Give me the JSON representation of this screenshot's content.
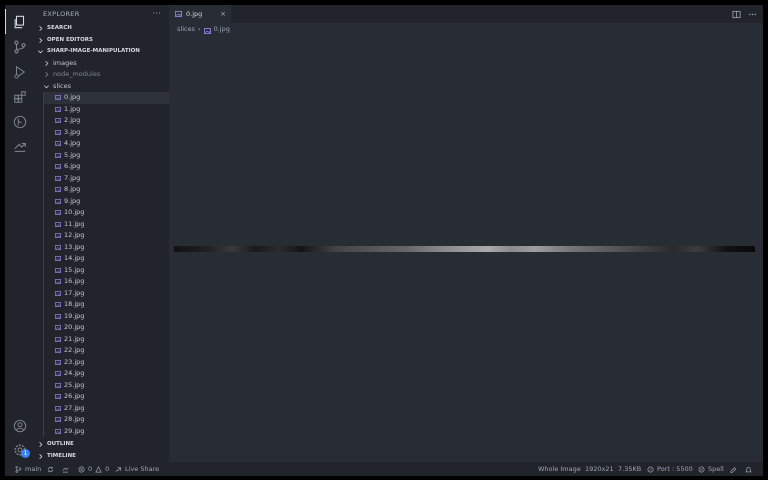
{
  "sidebar": {
    "title": "EXPLORER",
    "more": "···",
    "sections": {
      "search": "SEARCH",
      "open_editors": "OPEN EDITORS",
      "project": "SHARP-IMAGE-MANIPULATION",
      "outline": "OUTLINE",
      "timeline": "TIMELINE"
    },
    "folders": {
      "images": "images",
      "node_modules": "node_modules",
      "slices": "slices"
    },
    "files": [
      "0.jpg",
      "1.jpg",
      "2.jpg",
      "3.jpg",
      "4.jpg",
      "5.jpg",
      "6.jpg",
      "7.jpg",
      "8.jpg",
      "9.jpg",
      "10.jpg",
      "11.jpg",
      "12.jpg",
      "13.jpg",
      "14.jpg",
      "15.jpg",
      "16.jpg",
      "17.jpg",
      "18.jpg",
      "19.jpg",
      "20.jpg",
      "21.jpg",
      "22.jpg",
      "23.jpg",
      "24.jpg",
      "25.jpg",
      "26.jpg",
      "27.jpg",
      "28.jpg",
      "29.jpg"
    ]
  },
  "activity": {
    "settings_badge": "1"
  },
  "editor": {
    "tab_label": "0.jpg",
    "tab_close": "×",
    "breadcrumb": {
      "folder": "slices",
      "separator": "›",
      "file": "0.jpg"
    }
  },
  "status": {
    "branch": "main",
    "errors": "0",
    "warnings": "0",
    "live_share": "Live Share",
    "whole_image": "Whole Image",
    "dimensions": "1920x21",
    "size": "7.35KB",
    "port": "Port : 5500",
    "spell": "Spell"
  },
  "colors": {
    "accent": "#3b82f6",
    "background": "#282c34",
    "panel": "#21252b",
    "file_icon": "#a78bfa"
  }
}
